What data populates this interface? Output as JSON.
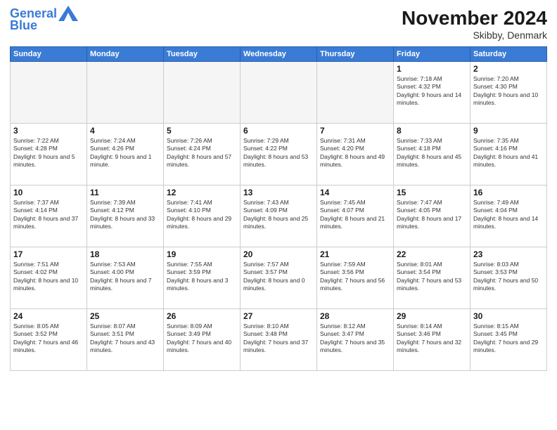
{
  "logo": {
    "line1": "General",
    "line2": "Blue"
  },
  "title": "November 2024",
  "location": "Skibby, Denmark",
  "weekdays": [
    "Sunday",
    "Monday",
    "Tuesday",
    "Wednesday",
    "Thursday",
    "Friday",
    "Saturday"
  ],
  "weeks": [
    [
      {
        "day": "",
        "info": ""
      },
      {
        "day": "",
        "info": ""
      },
      {
        "day": "",
        "info": ""
      },
      {
        "day": "",
        "info": ""
      },
      {
        "day": "",
        "info": ""
      },
      {
        "day": "1",
        "info": "Sunrise: 7:18 AM\nSunset: 4:32 PM\nDaylight: 9 hours and 14 minutes."
      },
      {
        "day": "2",
        "info": "Sunrise: 7:20 AM\nSunset: 4:30 PM\nDaylight: 9 hours and 10 minutes."
      }
    ],
    [
      {
        "day": "3",
        "info": "Sunrise: 7:22 AM\nSunset: 4:28 PM\nDaylight: 9 hours and 5 minutes."
      },
      {
        "day": "4",
        "info": "Sunrise: 7:24 AM\nSunset: 4:26 PM\nDaylight: 9 hours and 1 minute."
      },
      {
        "day": "5",
        "info": "Sunrise: 7:26 AM\nSunset: 4:24 PM\nDaylight: 8 hours and 57 minutes."
      },
      {
        "day": "6",
        "info": "Sunrise: 7:29 AM\nSunset: 4:22 PM\nDaylight: 8 hours and 53 minutes."
      },
      {
        "day": "7",
        "info": "Sunrise: 7:31 AM\nSunset: 4:20 PM\nDaylight: 8 hours and 49 minutes."
      },
      {
        "day": "8",
        "info": "Sunrise: 7:33 AM\nSunset: 4:18 PM\nDaylight: 8 hours and 45 minutes."
      },
      {
        "day": "9",
        "info": "Sunrise: 7:35 AM\nSunset: 4:16 PM\nDaylight: 8 hours and 41 minutes."
      }
    ],
    [
      {
        "day": "10",
        "info": "Sunrise: 7:37 AM\nSunset: 4:14 PM\nDaylight: 8 hours and 37 minutes."
      },
      {
        "day": "11",
        "info": "Sunrise: 7:39 AM\nSunset: 4:12 PM\nDaylight: 8 hours and 33 minutes."
      },
      {
        "day": "12",
        "info": "Sunrise: 7:41 AM\nSunset: 4:10 PM\nDaylight: 8 hours and 29 minutes."
      },
      {
        "day": "13",
        "info": "Sunrise: 7:43 AM\nSunset: 4:09 PM\nDaylight: 8 hours and 25 minutes."
      },
      {
        "day": "14",
        "info": "Sunrise: 7:45 AM\nSunset: 4:07 PM\nDaylight: 8 hours and 21 minutes."
      },
      {
        "day": "15",
        "info": "Sunrise: 7:47 AM\nSunset: 4:05 PM\nDaylight: 8 hours and 17 minutes."
      },
      {
        "day": "16",
        "info": "Sunrise: 7:49 AM\nSunset: 4:04 PM\nDaylight: 8 hours and 14 minutes."
      }
    ],
    [
      {
        "day": "17",
        "info": "Sunrise: 7:51 AM\nSunset: 4:02 PM\nDaylight: 8 hours and 10 minutes."
      },
      {
        "day": "18",
        "info": "Sunrise: 7:53 AM\nSunset: 4:00 PM\nDaylight: 8 hours and 7 minutes."
      },
      {
        "day": "19",
        "info": "Sunrise: 7:55 AM\nSunset: 3:59 PM\nDaylight: 8 hours and 3 minutes."
      },
      {
        "day": "20",
        "info": "Sunrise: 7:57 AM\nSunset: 3:57 PM\nDaylight: 8 hours and 0 minutes."
      },
      {
        "day": "21",
        "info": "Sunrise: 7:59 AM\nSunset: 3:56 PM\nDaylight: 7 hours and 56 minutes."
      },
      {
        "day": "22",
        "info": "Sunrise: 8:01 AM\nSunset: 3:54 PM\nDaylight: 7 hours and 53 minutes."
      },
      {
        "day": "23",
        "info": "Sunrise: 8:03 AM\nSunset: 3:53 PM\nDaylight: 7 hours and 50 minutes."
      }
    ],
    [
      {
        "day": "24",
        "info": "Sunrise: 8:05 AM\nSunset: 3:52 PM\nDaylight: 7 hours and 46 minutes."
      },
      {
        "day": "25",
        "info": "Sunrise: 8:07 AM\nSunset: 3:51 PM\nDaylight: 7 hours and 43 minutes."
      },
      {
        "day": "26",
        "info": "Sunrise: 8:09 AM\nSunset: 3:49 PM\nDaylight: 7 hours and 40 minutes."
      },
      {
        "day": "27",
        "info": "Sunrise: 8:10 AM\nSunset: 3:48 PM\nDaylight: 7 hours and 37 minutes."
      },
      {
        "day": "28",
        "info": "Sunrise: 8:12 AM\nSunset: 3:47 PM\nDaylight: 7 hours and 35 minutes."
      },
      {
        "day": "29",
        "info": "Sunrise: 8:14 AM\nSunset: 3:46 PM\nDaylight: 7 hours and 32 minutes."
      },
      {
        "day": "30",
        "info": "Sunrise: 8:15 AM\nSunset: 3:45 PM\nDaylight: 7 hours and 29 minutes."
      }
    ]
  ]
}
